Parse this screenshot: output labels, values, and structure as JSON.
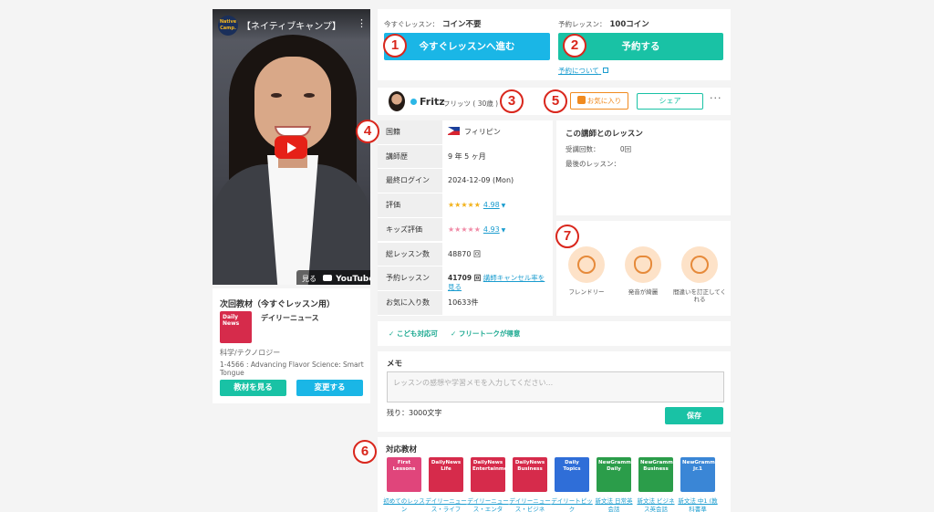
{
  "video": {
    "channel_logo": "Native Camp.",
    "title": "【ネイティブキャンプ】",
    "menu_icon": "⋮",
    "badge_prefix": "見る",
    "badge_brand": "YouTube"
  },
  "next_material": {
    "title": "次回教材（今すぐレッスン用）",
    "thumb_label": "Daily News",
    "name": "デイリーニュース",
    "category": "科学/テクノロジー",
    "lesson": "1-4566 : Advancing Flavor Science: Smart Tongue",
    "view_button": "教材を見る",
    "change_button": "変更する"
  },
  "booking": {
    "now_label": "今すぐレッスン：",
    "now_value": "コイン不要",
    "now_button": "今すぐレッスンへ進む",
    "reserve_label": "予約レッスン：",
    "reserve_value": "100コイン",
    "reserve_button": "予約する",
    "about_link": "予約について"
  },
  "tutor": {
    "name": "Fritz",
    "kana": "フリッツ ( 30歳 )",
    "favorite_button": "お気に入り",
    "share_button": "シェア",
    "more": "···"
  },
  "info": {
    "rows": [
      {
        "key": "国籍",
        "value": "フィリピン"
      },
      {
        "key": "講師歴",
        "value": "9 年 5 ヶ月"
      },
      {
        "key": "最終ログイン",
        "value": "2024-12-09 (Mon)"
      },
      {
        "key": "評価",
        "value": "4.98",
        "stars": "★★★★★"
      },
      {
        "key": "キッズ評価",
        "value": "4.93",
        "stars": "★★★★★"
      },
      {
        "key": "総レッスン数",
        "value": "48870 回"
      },
      {
        "key": "予約レッスン",
        "value": "41709 回",
        "link": "講師キャンセル率を見る"
      },
      {
        "key": "お気に入り数",
        "value": "10633件"
      }
    ]
  },
  "lessons": {
    "title": "この講師とのレッスン",
    "count_label": "受講回数：",
    "count_value": "0回",
    "last_label": "最後のレッスン："
  },
  "traits": [
    {
      "label": "フレンドリー"
    },
    {
      "label": "発音が綺麗"
    },
    {
      "label": "間違いを訂正してくれる"
    }
  ],
  "tags": [
    "✓ こども対応可",
    "✓ フリートークが得意"
  ],
  "memo": {
    "title": "メモ",
    "placeholder": "レッスンの感想や学習メモを入力してください...",
    "remaining": "残り：3000文字",
    "save_button": "保存"
  },
  "materials": {
    "title": "対応教材",
    "items": [
      {
        "thumb": "First Lessons",
        "link": "初めてのレッスン",
        "color": "#e0457b"
      },
      {
        "thumb": "DailyNews Life",
        "link": "デイリーニュース・ライフ",
        "color": "#d62b4b"
      },
      {
        "thumb": "DailyNews Entertainment",
        "link": "デイリーニュース・エンタ",
        "color": "#d62b4b"
      },
      {
        "thumb": "DailyNews Business",
        "link": "デイリーニュース・ビジネ",
        "color": "#d62b4b"
      },
      {
        "thumb": "Daily Topics",
        "link": "デイリートピック",
        "color": "#2f6ed8"
      },
      {
        "thumb": "NewGrammar Daily",
        "link": "新文法 日常英会話",
        "color": "#2b9d4a"
      },
      {
        "thumb": "NewGrammar Business",
        "link": "新文法 ビジネス英会話",
        "color": "#2b9d4a"
      },
      {
        "thumb": "NewGrammar Jr.1",
        "link": "新文法 中1 (教科書準",
        "color": "#3a86d6"
      }
    ]
  },
  "markers": [
    "1",
    "2",
    "3",
    "4",
    "5",
    "6",
    "7"
  ],
  "colors": {
    "teal": "#19c2a5",
    "sky": "#1ab6e6",
    "orange": "#f08a1f",
    "marker_red": "#d9261c"
  }
}
